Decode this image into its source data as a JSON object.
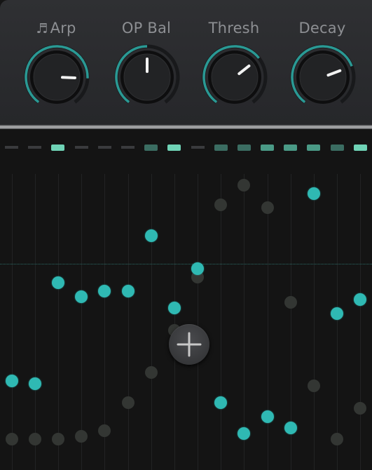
{
  "knobs": [
    {
      "label": "Arp",
      "icon": "music-note-icon",
      "value": 0.82
    },
    {
      "label": "OP Bal",
      "value": 0.5
    },
    {
      "label": "Thresh",
      "value": 0.68
    },
    {
      "label": "Decay",
      "value": 0.74
    }
  ],
  "colors": {
    "accent": "#2fb9b3",
    "ghost": "#333633",
    "panel": "#2b2c2f",
    "background": "#141414"
  },
  "sequencer": {
    "steps": 16,
    "step_states": [
      false,
      false,
      true,
      false,
      false,
      false,
      true,
      true,
      false,
      true,
      true,
      true,
      true,
      true,
      true,
      true
    ],
    "step_brightness": [
      0,
      0,
      1,
      0,
      0,
      0,
      0.5,
      1,
      0,
      0.5,
      0.5,
      0.7,
      0.7,
      0.8,
      0.5,
      1
    ],
    "active_values": [
      0.26,
      0.25,
      0.61,
      0.56,
      0.58,
      0.58,
      0.78,
      0.52,
      0.66,
      0.18,
      0.07,
      0.13,
      0.09,
      0.93,
      0.5,
      0.55
    ],
    "ghost_values": [
      0.05,
      0.05,
      0.05,
      0.06,
      0.08,
      0.18,
      0.29,
      0.44,
      0.63,
      0.89,
      0.96,
      0.88,
      0.54,
      0.24,
      0.05,
      0.16
    ],
    "add_button_label": "+"
  }
}
